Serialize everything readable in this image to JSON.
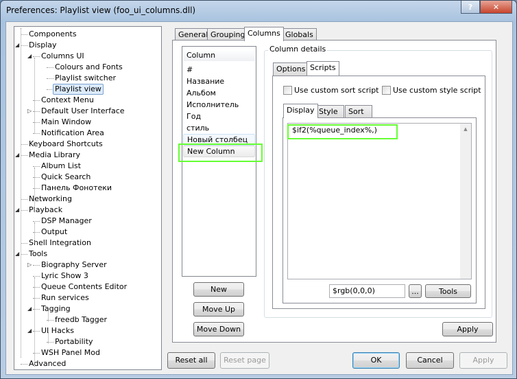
{
  "window": {
    "title": "Preferences: Playlist view (foo_ui_columns.dll)",
    "help_label": "?",
    "close_label": "✕"
  },
  "tree": [
    {
      "label": "Components",
      "level": 0
    },
    {
      "label": "Display",
      "level": 0,
      "expander": "expanded"
    },
    {
      "label": "Columns UI",
      "level": 1,
      "expander": "expanded"
    },
    {
      "label": "Colours and Fonts",
      "level": 2
    },
    {
      "label": "Playlist switcher",
      "level": 2
    },
    {
      "label": "Playlist view",
      "level": 2,
      "selected": true
    },
    {
      "label": "Context Menu",
      "level": 1
    },
    {
      "label": "Default User Interface",
      "level": 1,
      "expander": "collapsed"
    },
    {
      "label": "Main Window",
      "level": 1
    },
    {
      "label": "Notification Area",
      "level": 1
    },
    {
      "label": "Keyboard Shortcuts",
      "level": 0
    },
    {
      "label": "Media Library",
      "level": 0,
      "expander": "expanded"
    },
    {
      "label": "Album List",
      "level": 1
    },
    {
      "label": "Quick Search",
      "level": 1
    },
    {
      "label": "Панель Фонотеки",
      "level": 1
    },
    {
      "label": "Networking",
      "level": 0
    },
    {
      "label": "Playback",
      "level": 0,
      "expander": "expanded"
    },
    {
      "label": "DSP Manager",
      "level": 1
    },
    {
      "label": "Output",
      "level": 1
    },
    {
      "label": "Shell Integration",
      "level": 0
    },
    {
      "label": "Tools",
      "level": 0,
      "expander": "expanded"
    },
    {
      "label": "Biography Server",
      "level": 1,
      "expander": "collapsed"
    },
    {
      "label": "Lyric Show 3",
      "level": 1
    },
    {
      "label": "Queue Contents Editor",
      "level": 1
    },
    {
      "label": "Run services",
      "level": 1
    },
    {
      "label": "Tagging",
      "level": 1,
      "expander": "expanded"
    },
    {
      "label": "freedb Tagger",
      "level": 2
    },
    {
      "label": "UI Hacks",
      "level": 1,
      "expander": "expanded"
    },
    {
      "label": "Portability",
      "level": 2
    },
    {
      "label": "WSH Panel Mod",
      "level": 1
    },
    {
      "label": "Advanced",
      "level": 0
    }
  ],
  "tabs": [
    "General",
    "Grouping",
    "Columns",
    "Globals"
  ],
  "active_tab": "Columns",
  "columns": {
    "header": "Column",
    "items": [
      "#",
      "Название",
      "Альбом",
      "Исполнитель",
      "Год",
      "стиль",
      "Новый столбец",
      "New Column"
    ],
    "selected": "New Column"
  },
  "column_buttons": {
    "new": "New",
    "move_up": "Move Up",
    "move_down": "Move Down"
  },
  "details": {
    "group_label": "Column details",
    "tabs": [
      "Options",
      "Scripts"
    ],
    "active_tab": "Scripts",
    "sort_script_label": "Use custom sort script",
    "sort_script_checked": false,
    "style_script_label": "Use custom style script",
    "style_script_checked": false,
    "script_tabs": [
      "Display",
      "Style",
      "Sort"
    ],
    "active_script_tab": "Display",
    "script": "$if2(%queue_index%,)",
    "color_value": "$rgb(0,0,0)",
    "ellipsis_label": "...",
    "tools_label": "Tools",
    "apply_label": "Apply"
  },
  "footer": {
    "reset_all": "Reset all",
    "reset_page": "Reset page",
    "ok": "OK",
    "cancel": "Cancel",
    "apply": "Apply"
  }
}
